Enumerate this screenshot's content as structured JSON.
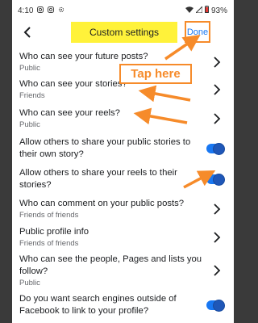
{
  "status": {
    "time": "4:10",
    "battery": "93%",
    "icons": [
      "instagram-icon",
      "instagram-icon",
      "settings-icon",
      "wifi-icon",
      "signal-icon",
      "battery-icon"
    ]
  },
  "header": {
    "title": "Custom settings",
    "done_label": "Done",
    "back_icon": "chevron-left-icon"
  },
  "annotation": {
    "tap_label": "Tap here",
    "color": "#f68b2a"
  },
  "rows": [
    {
      "label": "Who can see your future posts?",
      "sub": "Public",
      "control": "chevron"
    },
    {
      "label": "Who can see your stories?",
      "sub": "Friends",
      "control": "chevron"
    },
    {
      "label": "Who can see your reels?",
      "sub": "Public",
      "control": "chevron"
    },
    {
      "label": "Allow others to share your public stories to their own story?",
      "sub": "",
      "control": "toggle",
      "on": true
    },
    {
      "label": "Allow others to share your reels to their stories?",
      "sub": "",
      "control": "toggle",
      "on": true
    },
    {
      "label": "Who can comment on your public posts?",
      "sub": "Friends of friends",
      "control": "chevron"
    },
    {
      "label": "Public profile info",
      "sub": "Friends of friends",
      "control": "chevron"
    },
    {
      "label": "Who can see the people, Pages and lists you follow?",
      "sub": "Public",
      "control": "chevron"
    },
    {
      "label": "Do you want search engines outside of Facebook to link to your profile?",
      "sub": "",
      "control": "toggle",
      "on": true
    }
  ],
  "colors": {
    "accent": "#1877f2",
    "highlight": "#fff23a",
    "arrow": "#f68b2a"
  }
}
